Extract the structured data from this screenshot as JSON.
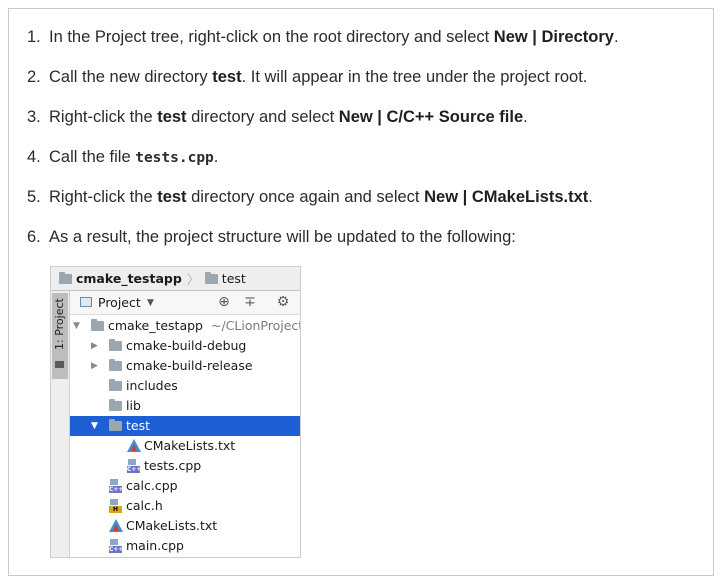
{
  "steps": [
    {
      "num": "1.",
      "parts": [
        [
          "In the Project tree, right-click on the root directory and select ",
          "n"
        ],
        [
          "New | Directory",
          "b"
        ],
        [
          ".",
          "n"
        ]
      ]
    },
    {
      "num": "2.",
      "parts": [
        [
          "Call the new directory ",
          "n"
        ],
        [
          "test",
          "b"
        ],
        [
          ". It will appear in the tree under the project root.",
          "n"
        ]
      ]
    },
    {
      "num": "3.",
      "parts": [
        [
          "Right-click the ",
          "n"
        ],
        [
          "test",
          "b"
        ],
        [
          " directory and select ",
          "n"
        ],
        [
          "New | C/C++ Source file",
          "b"
        ],
        [
          ".",
          "n"
        ]
      ]
    },
    {
      "num": "4.",
      "parts": [
        [
          "Call the file ",
          "n"
        ],
        [
          "tests.cpp",
          "c"
        ],
        [
          ".",
          "n"
        ]
      ]
    },
    {
      "num": "5.",
      "parts": [
        [
          "Right-click the ",
          "n"
        ],
        [
          "test",
          "b"
        ],
        [
          " directory once again and select ",
          "n"
        ],
        [
          "New | CMakeLists.txt",
          "b"
        ],
        [
          ".",
          "n"
        ]
      ]
    },
    {
      "num": "6.",
      "parts": [
        [
          "As a result, the project structure will be updated to the following:",
          "n"
        ]
      ]
    }
  ],
  "ide": {
    "breadcrumb": {
      "root": "cmake_testapp",
      "child": "test",
      "separator": "〉"
    },
    "sidebar_tab": "1: Project",
    "toolbar": {
      "label": "Project",
      "dropdown": "▼",
      "icons": [
        "target-icon",
        "collapse-icon",
        "gear-icon"
      ]
    },
    "tree": [
      {
        "label": "cmake_testapp",
        "hint": "~/CLionProject",
        "icon": "folder",
        "arrow": "▼",
        "selected": false
      },
      {
        "label": "cmake-build-debug",
        "icon": "folder",
        "arrow": "▶",
        "selected": false
      },
      {
        "label": "cmake-build-release",
        "icon": "folder",
        "arrow": "▶",
        "selected": false
      },
      {
        "label": "includes",
        "icon": "folder",
        "arrow": "",
        "selected": false
      },
      {
        "label": "lib",
        "icon": "folder",
        "arrow": "",
        "selected": false
      },
      {
        "label": "test",
        "icon": "folder",
        "arrow": "▼",
        "selected": true
      },
      {
        "label": "CMakeLists.txt",
        "icon": "cmake",
        "arrow": "",
        "selected": false
      },
      {
        "label": "tests.cpp",
        "icon": "cpp",
        "arrow": "",
        "selected": false
      },
      {
        "label": "calc.cpp",
        "icon": "cpp",
        "arrow": "",
        "selected": false
      },
      {
        "label": "calc.h",
        "icon": "h",
        "arrow": "",
        "selected": false
      },
      {
        "label": "CMakeLists.txt",
        "icon": "cmake",
        "arrow": "",
        "selected": false
      },
      {
        "label": "main.cpp",
        "icon": "cpp",
        "arrow": "",
        "selected": false
      }
    ],
    "badges": {
      "cpp": "C++",
      "h": "H"
    },
    "colors": {
      "selection": "#1f5fd6",
      "folder": "#9aa7b0",
      "cmake_blue": "#3e8fd6",
      "cmake_red": "#d23a3a",
      "cpp_badge": "#6c74c9",
      "h_badge": "#e0a219"
    }
  }
}
